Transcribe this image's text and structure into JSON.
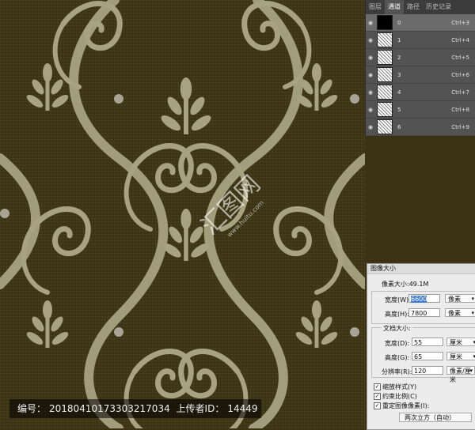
{
  "watermark": {
    "footer_id_label": "编号：",
    "footer_id": "20180410173303217034",
    "footer_uploader_label": "上传者ID：",
    "footer_uploader": "14449",
    "brand": "汇图网",
    "brand_url": "www.huitu.com"
  },
  "panel": {
    "tabs": [
      "图层",
      "通道",
      "路径",
      "历史记录"
    ],
    "active_tab": 1,
    "channels": [
      {
        "name": "0",
        "shortcut": "Ctrl+3",
        "thumb": "black"
      },
      {
        "name": "1",
        "shortcut": "Ctrl+4",
        "thumb": "tex"
      },
      {
        "name": "2",
        "shortcut": "Ctrl+5",
        "thumb": "tex"
      },
      {
        "name": "3",
        "shortcut": "Ctrl+6",
        "thumb": "tex"
      },
      {
        "name": "4",
        "shortcut": "Ctrl+7",
        "thumb": "tex"
      },
      {
        "name": "5",
        "shortcut": "Ctrl+8",
        "thumb": "tex"
      },
      {
        "name": "6",
        "shortcut": "Ctrl+9",
        "thumb": "tex"
      }
    ]
  },
  "dialog": {
    "title": "图像大小",
    "pixel_size_label": "像素大小:49.1M",
    "width_label": "宽度(W):",
    "width_value": "6600",
    "height_label": "高度(H):",
    "height_value": "7800",
    "pixel_unit": "像素",
    "doc_size_label": "文档大小:",
    "doc_width_label": "宽度(D):",
    "doc_width_value": "55",
    "doc_height_label": "高度(G):",
    "doc_height_value": "65",
    "doc_unit": "厘米",
    "resolution_label": "分辨率(R):",
    "resolution_value": "120",
    "resolution_unit": "像素/厘米",
    "scale_styles": "缩放样式(Y)",
    "constrain": "约束比例(C)",
    "resample": "重定图像像素(I):",
    "resample_method": "两次立方（自动）"
  },
  "colors": {
    "canvas_bg": "#3f3716",
    "ornament": "#a8a280",
    "panel_bg": "#535353"
  }
}
